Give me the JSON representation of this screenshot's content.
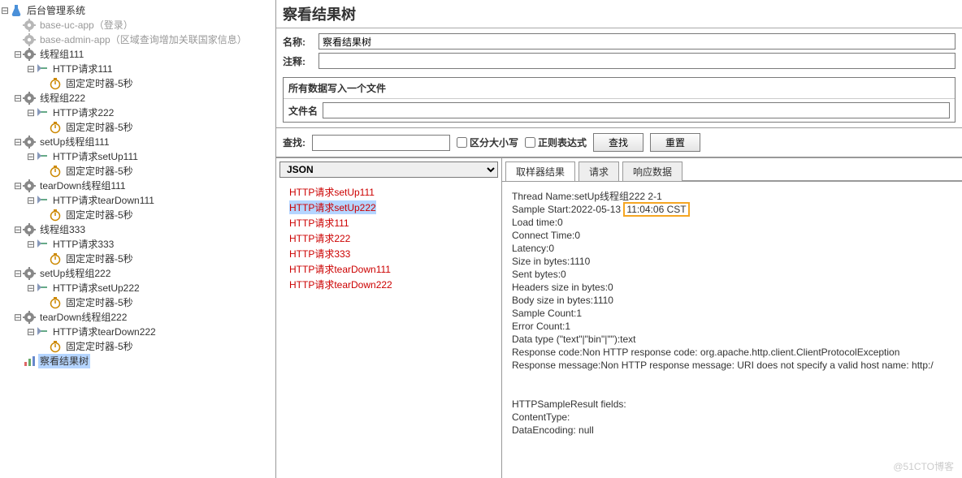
{
  "tree": {
    "root": {
      "label": "后台管理系统",
      "icon": "flask"
    },
    "nodes": [
      {
        "label": "base-uc-app（登录）",
        "icon": "gear",
        "disabled": true,
        "indent": 1
      },
      {
        "label": "base-admin-app（区域查询增加关联国家信息）",
        "icon": "gear",
        "disabled": true,
        "indent": 1
      },
      {
        "label": "线程组111",
        "icon": "gear",
        "indent": 1,
        "children": [
          {
            "label": "HTTP请求111",
            "icon": "http",
            "indent": 2,
            "children": [
              {
                "label": "固定定时器-5秒",
                "icon": "timer",
                "indent": 3
              }
            ]
          }
        ]
      },
      {
        "label": "线程组222",
        "icon": "gear",
        "indent": 1,
        "children": [
          {
            "label": "HTTP请求222",
            "icon": "http",
            "indent": 2,
            "children": [
              {
                "label": "固定定时器-5秒",
                "icon": "timer",
                "indent": 3
              }
            ]
          }
        ]
      },
      {
        "label": "setUp线程组111",
        "icon": "gear",
        "indent": 1,
        "children": [
          {
            "label": "HTTP请求setUp111",
            "icon": "http",
            "indent": 2,
            "children": [
              {
                "label": "固定定时器-5秒",
                "icon": "timer",
                "indent": 3
              }
            ]
          }
        ]
      },
      {
        "label": "tearDown线程组111",
        "icon": "gear",
        "indent": 1,
        "children": [
          {
            "label": "HTTP请求tearDown111",
            "icon": "http",
            "indent": 2,
            "children": [
              {
                "label": "固定定时器-5秒",
                "icon": "timer",
                "indent": 3
              }
            ]
          }
        ]
      },
      {
        "label": "线程组333",
        "icon": "gear",
        "indent": 1,
        "children": [
          {
            "label": "HTTP请求333",
            "icon": "http",
            "indent": 2,
            "children": [
              {
                "label": "固定定时器-5秒",
                "icon": "timer",
                "indent": 3
              }
            ]
          }
        ]
      },
      {
        "label": "setUp线程组222",
        "icon": "gear",
        "indent": 1,
        "children": [
          {
            "label": "HTTP请求setUp222",
            "icon": "http",
            "indent": 2,
            "children": [
              {
                "label": "固定定时器-5秒",
                "icon": "timer",
                "indent": 3
              }
            ]
          }
        ]
      },
      {
        "label": "tearDown线程组222",
        "icon": "gear",
        "indent": 1,
        "children": [
          {
            "label": "HTTP请求tearDown222",
            "icon": "http",
            "indent": 2,
            "children": [
              {
                "label": "固定定时器-5秒",
                "icon": "timer",
                "indent": 3
              }
            ]
          }
        ]
      },
      {
        "label": "察看结果树",
        "icon": "chart",
        "indent": 1,
        "sel": true
      }
    ]
  },
  "header": {
    "title": "察看结果树"
  },
  "form": {
    "name_label": "名称:",
    "name_value": "察看结果树",
    "comment_label": "注释:",
    "comment_value": ""
  },
  "file_section": {
    "title": "所有数据写入一个文件",
    "filename_label": "文件名",
    "filename_value": ""
  },
  "search": {
    "label": "查找:",
    "value": "",
    "chk_case": "区分大小写",
    "chk_regex": "正则表达式",
    "btn_find": "查找",
    "btn_reset": "重置"
  },
  "result_list": {
    "renderer": "JSON",
    "items": [
      "HTTP请求setUp111",
      "HTTP请求setUp222",
      "HTTP请求111",
      "HTTP请求222",
      "HTTP请求333",
      "HTTP请求tearDown111",
      "HTTP请求tearDown222"
    ],
    "selected": 1
  },
  "tabs": {
    "items": [
      "取样器结果",
      "请求",
      "响应数据"
    ],
    "active": 0
  },
  "detail": {
    "lines": [
      "Thread Name:setUp线程组222 2-1",
      "Sample Start:2022-05-13",
      "Load time:0",
      "Connect Time:0",
      "Latency:0",
      "Size in bytes:1110",
      "Sent bytes:0",
      "Headers size in bytes:0",
      "Body size in bytes:1110",
      "Sample Count:1",
      "Error Count:1",
      "Data type (\"text\"|\"bin\"|\"\"):text",
      "Response code:Non HTTP response code: org.apache.http.client.ClientProtocolException",
      "Response message:Non HTTP response message: URI does not specify a valid host name: http:/",
      "",
      "",
      "HTTPSampleResult fields:",
      "ContentType:",
      "DataEncoding: null"
    ],
    "highlight": "11:04:06 CST"
  },
  "watermark": "@51CTO博客"
}
